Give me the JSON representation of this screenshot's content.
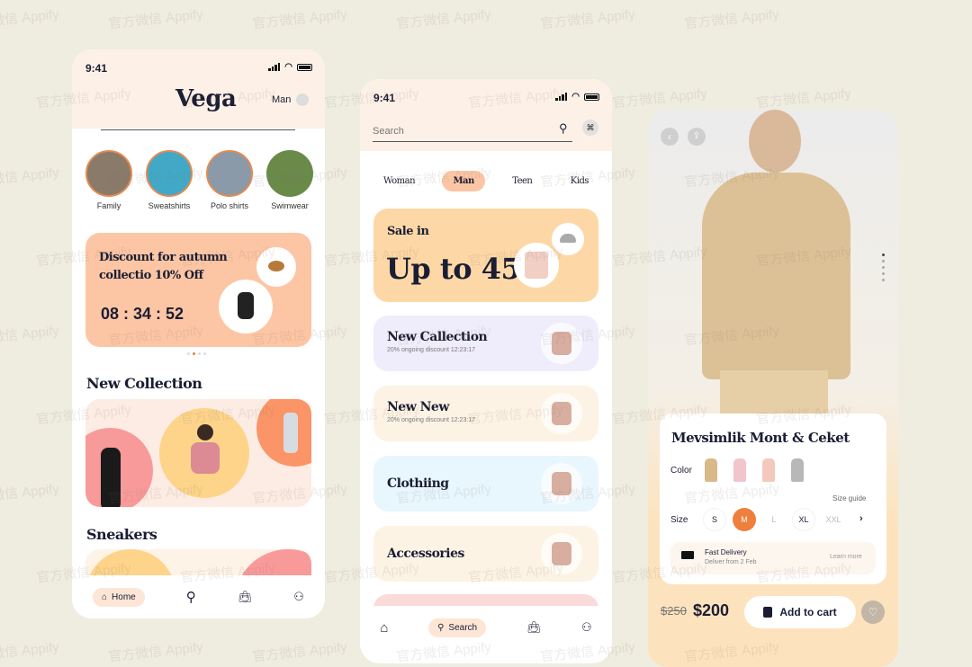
{
  "watermark": "官方微信 Appify",
  "status": {
    "time": "9:41"
  },
  "home": {
    "logo": "Vega",
    "gender": "Man",
    "categories": [
      {
        "label": "Family"
      },
      {
        "label": "Sweatshirts"
      },
      {
        "label": "Polo shirts"
      },
      {
        "label": "Swimwear"
      }
    ],
    "promo": {
      "title_line1": "Discount for autumn",
      "title_line2": "collectio 10% Off",
      "timer": "08 : 34 : 52"
    },
    "section1": "New Collection",
    "section2": "Sneakers",
    "nav": {
      "home": "Home"
    }
  },
  "search_screen": {
    "search_placeholder": "Search",
    "tabs": [
      {
        "label": "Woman"
      },
      {
        "label": "Man",
        "active": true
      },
      {
        "label": "Teen"
      },
      {
        "label": "Kids"
      }
    ],
    "sale": {
      "small": "Sale in",
      "big": "Up to 45"
    },
    "cards": [
      {
        "title": "New Callection",
        "subtitle": "20% ongoing discount 12:23:17",
        "color": "#efedfb"
      },
      {
        "title": "New New",
        "subtitle": "20% ongoing discount 12:23:17",
        "color": "#fdf3e4"
      },
      {
        "title": "Clothiing",
        "subtitle": "",
        "color": "#e8f6fd"
      },
      {
        "title": "Accessories",
        "subtitle": "",
        "color": "#fdf3e4"
      }
    ],
    "nav": {
      "search": "Search"
    }
  },
  "product": {
    "name": "Mevsimlik Mont & Ceket",
    "color_label": "Color",
    "size_label": "Size",
    "size_guide": "Size guide",
    "sizes": [
      {
        "label": "S"
      },
      {
        "label": "M",
        "selected": true
      },
      {
        "label": "L"
      },
      {
        "label": "XL"
      },
      {
        "label": "XXL"
      }
    ],
    "delivery": {
      "title": "Fast Delivery",
      "subtitle": "Deliver from 2 Feb",
      "link": "Learn more"
    },
    "old_price": "$250",
    "price": "$200",
    "add_to_cart": "Add to cart"
  },
  "colors": {
    "accent": "#ee7f3c",
    "peach": "#fcc6a4",
    "sand": "#fde1b6",
    "navy": "#1a1d33"
  }
}
